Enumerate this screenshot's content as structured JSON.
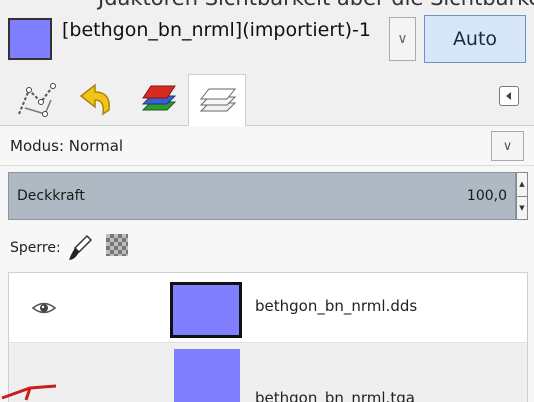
{
  "top_cut_text": "Jdaktoren Sichtbarkeit aber die Sichtbarkeit",
  "image_menu": {
    "title": "[bethgon_bn_nrml](importiert)-1",
    "swatch_color": "#7f7fff",
    "auto_label": "Auto"
  },
  "tabs": [
    {
      "name": "paths",
      "icon": "paths-icon"
    },
    {
      "name": "undo-history",
      "icon": "undo-history-icon"
    },
    {
      "name": "channels",
      "icon": "channels-icon"
    },
    {
      "name": "layers",
      "icon": "layers-icon",
      "active": true
    }
  ],
  "layers_panel": {
    "mode_label": "Modus: Normal",
    "opacity_label": "Deckkraft",
    "opacity_value": "100,0",
    "lock_label": "Sperre:",
    "layers": [
      {
        "name": "bethgon_bn_nrml.dds",
        "visible": true,
        "thumb_color": "#7f7fff",
        "selected": true
      },
      {
        "name": "bethgon_bn_nrml.tga",
        "visible": false,
        "thumb_color": "#7f7fff",
        "selected": false
      }
    ]
  },
  "colors": {
    "accent": "#7f7fff",
    "auto_bg": "#d7e6f8",
    "opacity_bg": "#aeb9c4"
  }
}
